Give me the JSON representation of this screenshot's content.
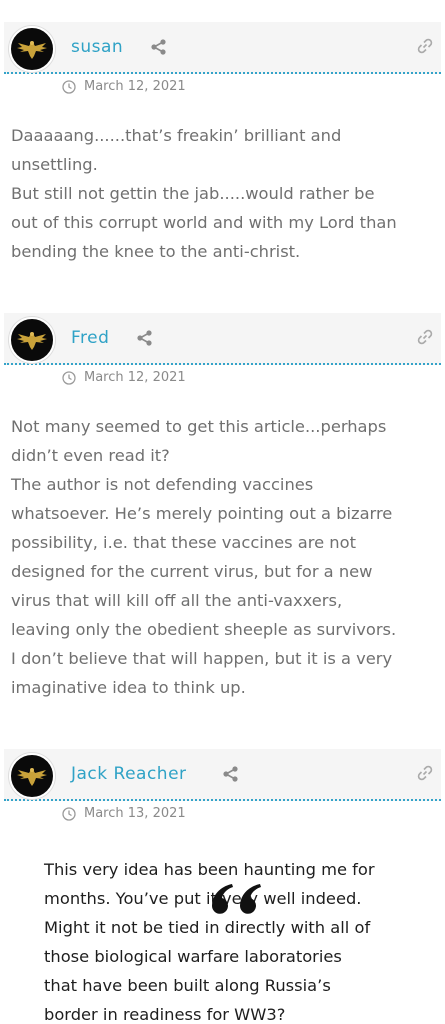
{
  "comments": [
    {
      "author": "susan",
      "date": "March 12, 2021",
      "body": [
        "Daaaaang......that’s freakin’ brilliant and",
        "unsettling.",
        "But still not gettin the jab.....would rather be",
        "out of this corrupt world and with my Lord than",
        "bending the knee to the anti-christ."
      ]
    },
    {
      "author": "Fred",
      "date": "March 12, 2021",
      "body": [
        "Not many seemed to get this article...perhaps",
        "didn’t even read it?",
        "The author is not defending vaccines",
        "whatsoever. He’s merely pointing out a bizarre",
        "possibility, i.e. that these vaccines are not",
        "designed for the current virus, but for a new",
        "virus that will kill off all the anti-vaxxers,",
        "leaving only the obedient sheeple as survivors.",
        "I don’t believe that will happen, but it is a very",
        "imaginative idea to think up."
      ]
    },
    {
      "author": "Jack Reacher",
      "date": "March 13, 2021",
      "quote": [
        "This very idea has been haunting me for",
        "months. You’ve put it very well indeed.",
        "Might it not be tied in directly with all of",
        "those biological warfare laboratories",
        "that have been built along Russia’s",
        "border in readiness for WW3?"
      ]
    }
  ],
  "icons": {
    "avatar": "eagle-emblem-icon",
    "share": "share-icon",
    "link": "link-icon",
    "clock": "clock-icon",
    "quote": "quote-icon"
  },
  "colors": {
    "author": "#2fa2c6",
    "divider": "#33a3c9",
    "header_bg": "#f5f5f5",
    "body_text": "#707070",
    "quote_text": "#1e1e1e"
  }
}
